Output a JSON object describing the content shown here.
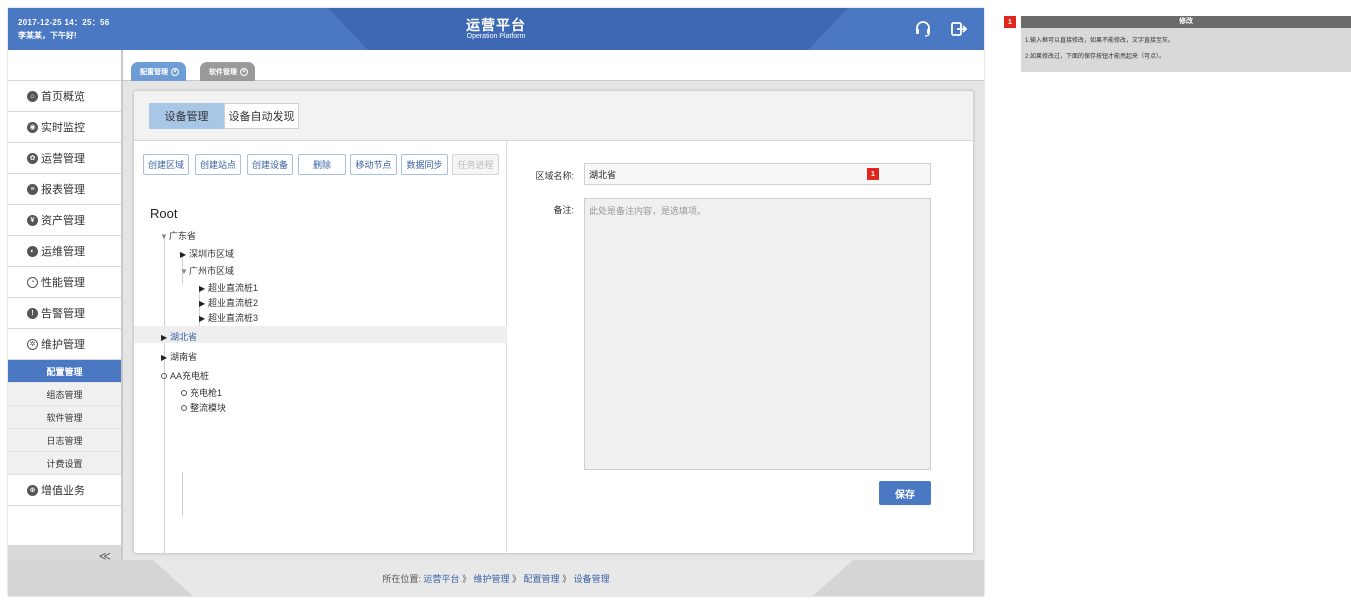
{
  "header": {
    "datetime": "2017-12-25  14：25：56",
    "greeting": "李某某，下午好!",
    "title": "运营平台",
    "subtitle": "Operation Platform",
    "icons": [
      "headset-icon",
      "logout-icon"
    ]
  },
  "sidebar": {
    "items": [
      {
        "label": "首页概览",
        "icon": "home-icon"
      },
      {
        "label": "实时监控",
        "icon": "monitor-icon"
      },
      {
        "label": "运营管理",
        "icon": "operations-icon"
      },
      {
        "label": "报表管理",
        "icon": "report-icon"
      },
      {
        "label": "资产管理",
        "icon": "asset-icon"
      },
      {
        "label": "运维管理",
        "icon": "maintenance-icon"
      },
      {
        "label": "性能管理",
        "icon": "gauge-icon"
      },
      {
        "label": "告警管理",
        "icon": "alert-icon"
      },
      {
        "label": "维护管理",
        "icon": "settings-icon"
      }
    ],
    "subitems": [
      {
        "label": "配置管理",
        "active": true
      },
      {
        "label": "组态管理",
        "active": false
      },
      {
        "label": "软件管理",
        "active": false
      },
      {
        "label": "日志管理",
        "active": false
      },
      {
        "label": "计费设置",
        "active": false
      }
    ],
    "extra": {
      "label": "增值业务",
      "icon": "value-added-icon"
    },
    "collapse_glyph": "≪"
  },
  "page_tabs": [
    {
      "label": "配置管理",
      "active": true
    },
    {
      "label": "软件管理",
      "active": false
    }
  ],
  "subtabs": [
    {
      "label": "设备管理",
      "active": true
    },
    {
      "label": "设备自动发现",
      "active": false
    }
  ],
  "toolbar": {
    "buttons": [
      {
        "label": "创建区域",
        "disabled": false
      },
      {
        "label": "创建站点",
        "disabled": false
      },
      {
        "label": "创建设备",
        "disabled": false
      },
      {
        "label": "删除",
        "disabled": false
      },
      {
        "label": "移动节点",
        "disabled": false
      },
      {
        "label": "数据同步",
        "disabled": false
      },
      {
        "label": "任务进程",
        "disabled": true
      }
    ]
  },
  "tree": {
    "root": "Root",
    "nodes": [
      {
        "label": "广东省",
        "expanded": true
      },
      {
        "label": "深圳市区域",
        "expanded": false
      },
      {
        "label": "广州市区域",
        "expanded": true
      },
      {
        "label": "超业直流桩1",
        "expanded": false
      },
      {
        "label": "超业直流桩2",
        "expanded": false
      },
      {
        "label": "超业直流桩3",
        "expanded": false
      },
      {
        "label": "湖北省",
        "expanded": false,
        "selected": true
      },
      {
        "label": "湖南省",
        "expanded": false
      },
      {
        "label": "AA充电桩",
        "leaf": true
      },
      {
        "label": "充电枪1",
        "leaf": true
      },
      {
        "label": "整流模块",
        "leaf": true
      }
    ]
  },
  "form": {
    "region_label": "区域名称:",
    "region_value": "湖北省",
    "remark_label": "备注:",
    "remark_placeholder": "此处是备注内容，是选填项。",
    "marker": "1",
    "save_label": "保存"
  },
  "footer": {
    "prefix": "所在位置:",
    "crumbs": [
      "运营平台",
      "维护管理",
      "配置管理",
      "设备管理"
    ],
    "separator": "》"
  },
  "annotation": {
    "badge": "1",
    "title": "修改",
    "lines": [
      "1.输入框可以直接修改，如果不能修改，文字直接至灰。",
      "2.如果修改过，下面的保存按钮才能亮起来（可点）。"
    ]
  },
  "colors": {
    "header_blue": "#4a78c2",
    "accent_blue": "#3a62a6",
    "selected_tab": "#a8c7e6",
    "marker_red": "#e1261c"
  }
}
